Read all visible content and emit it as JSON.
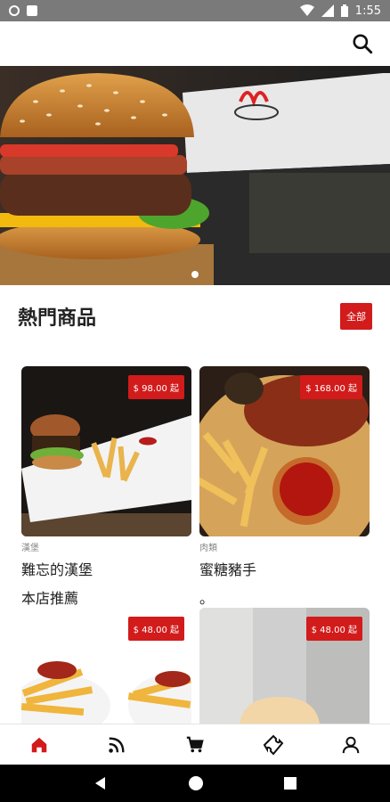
{
  "status": {
    "time": "1:55"
  },
  "section": {
    "title": "熱門商品",
    "all_label": "全部"
  },
  "products": [
    {
      "price": "$ 98.00 起",
      "category": "漢堡",
      "name": "難忘的漢堡",
      "desc": "本店推薦"
    },
    {
      "price": "$ 168.00 起",
      "category": "肉類",
      "name": "蜜糖豬手",
      "desc": "。"
    },
    {
      "price": "$ 48.00 起",
      "category": "",
      "name": "",
      "desc": ""
    },
    {
      "price": "$ 48.00 起",
      "category": "",
      "name": "",
      "desc": ""
    }
  ],
  "banner": {
    "logo_text": "Manny's",
    "slide_index": 1,
    "slide_count": 1
  },
  "tabs": [
    "home-icon",
    "rss-icon",
    "cart-icon",
    "ticket-icon",
    "person-icon"
  ],
  "colors": {
    "accent": "#d21b1b"
  }
}
